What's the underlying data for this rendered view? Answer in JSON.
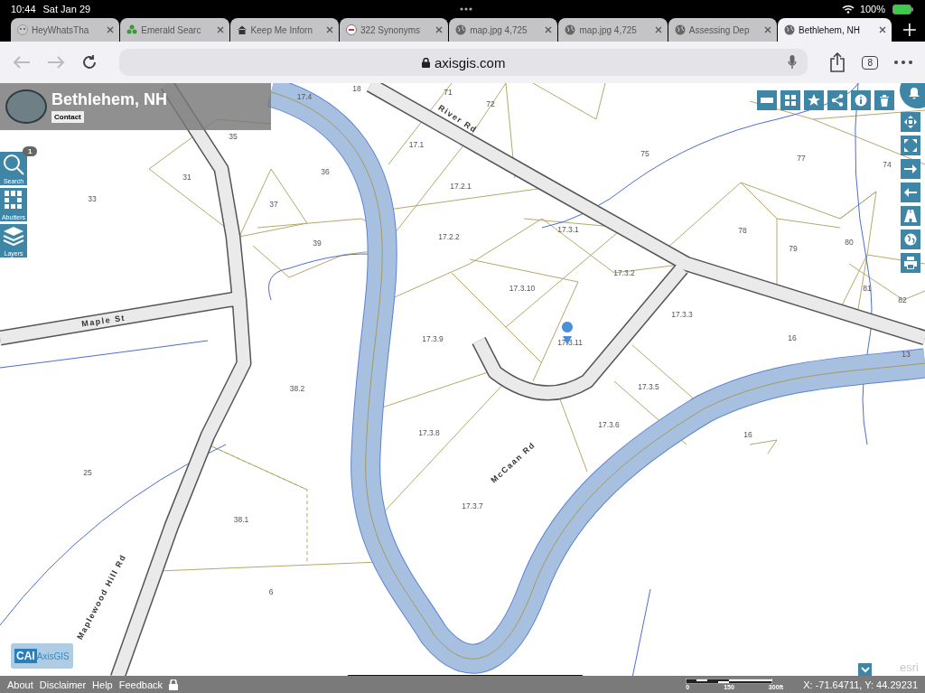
{
  "status_bar": {
    "time": "10:44",
    "date": "Sat Jan 29",
    "battery": "100%"
  },
  "tabs": [
    {
      "title": "HeyWhatsTha",
      "kind": "face",
      "selected": false
    },
    {
      "title": "Emerald Searc",
      "kind": "leaf",
      "selected": false
    },
    {
      "title": "Keep Me Inforn",
      "kind": "home",
      "selected": false
    },
    {
      "title": "322 Synonyms",
      "kind": "seal",
      "selected": false
    },
    {
      "title": "map.jpg 4,725",
      "kind": "globe",
      "selected": false
    },
    {
      "title": "map.jpg 4,725",
      "kind": "globe",
      "selected": false
    },
    {
      "title": "Assessing Dep",
      "kind": "globe",
      "selected": false
    },
    {
      "title": "Bethlehem, NH",
      "kind": "globe",
      "selected": true
    }
  ],
  "address_bar": {
    "url": "axisgis.com",
    "tab_count": "8"
  },
  "header": {
    "title": "Bethlehem, NH",
    "contact": "Contact"
  },
  "tools": [
    {
      "label": "Search",
      "kind": "search",
      "badge": "1"
    },
    {
      "label": "Abutters",
      "kind": "abutters"
    },
    {
      "label": "Layers",
      "kind": "layers"
    }
  ],
  "map": {
    "parcels": [
      "17.4",
      "18",
      "71",
      "72",
      "35",
      "17.1",
      "36",
      "31",
      "75",
      "77",
      "74",
      "33",
      "17.2.1",
      "37",
      "17.3.1",
      "78",
      "79",
      "80",
      "17.2.2",
      "39",
      "17.3.2",
      "17.3.10",
      "81",
      "82",
      "17.3.3",
      "16",
      "17.3.9",
      "17.3.11",
      "13",
      "38.2",
      "17.3.5",
      "17.3.8",
      "17.3.6",
      "16",
      "25",
      "17.3.7",
      "38.1",
      "6"
    ],
    "roads": [
      "River Rd",
      "Maple St",
      "McCaan Rd",
      "Maplewood Hill Rd"
    ]
  },
  "logo": {
    "mark": "CAI",
    "name": "AxisGIS"
  },
  "attribution": "esri",
  "footer": {
    "links": [
      "About",
      "Disclaimer",
      "Help",
      "Feedback"
    ],
    "scale": [
      "0",
      "150",
      "300ft"
    ],
    "coordinates": "X: -71.64711, Y: 44.29231"
  }
}
